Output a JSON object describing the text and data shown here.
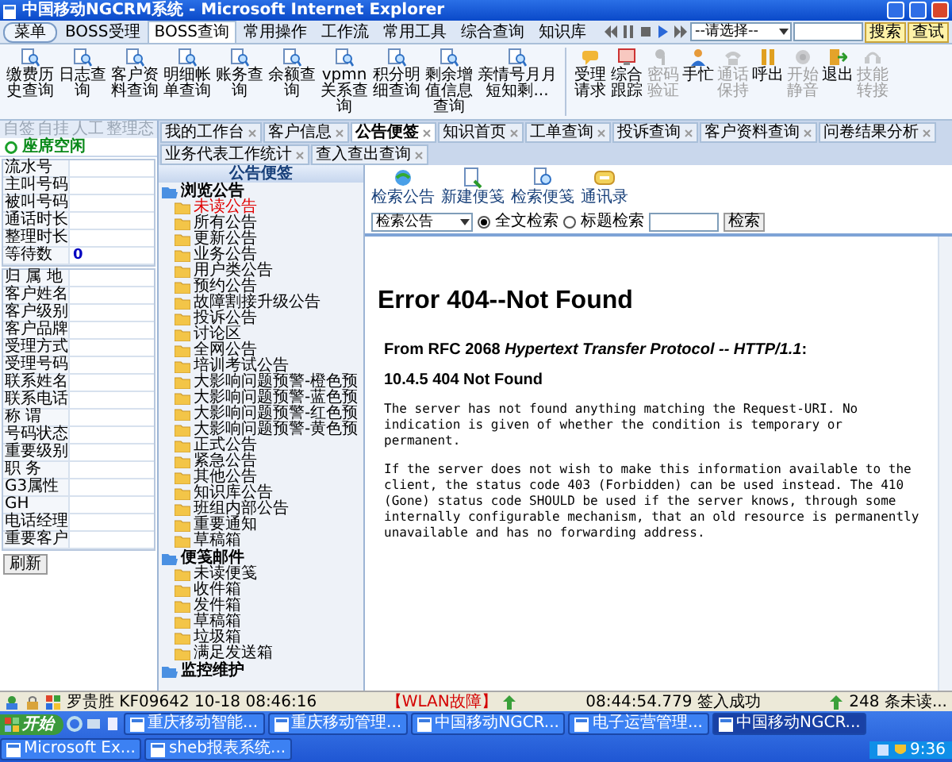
{
  "window": {
    "title": "中国移动NGCRM系统 - Microsoft Internet Explorer"
  },
  "menu_bar": {
    "menu_button": "菜单",
    "tabs": [
      {
        "label": "BOSS受理",
        "selected": false
      },
      {
        "label": "BOSS查询",
        "selected": true
      },
      {
        "label": "常用操作",
        "selected": false
      },
      {
        "label": "工作流",
        "selected": false
      },
      {
        "label": "常用工具",
        "selected": false
      },
      {
        "label": "综合查询",
        "selected": false
      },
      {
        "label": "知识库",
        "selected": false
      }
    ],
    "select": "--请选择--",
    "search_button": "搜索",
    "query_button": "查试"
  },
  "toolbar": {
    "query_tools": [
      {
        "label": "缴费历史查询"
      },
      {
        "label": "日志查询"
      },
      {
        "label": "客户资料查询"
      },
      {
        "label": "明细帐单查询"
      },
      {
        "label": "账务查询"
      },
      {
        "label": "余额查询"
      },
      {
        "label": "vpmn关系查询"
      },
      {
        "label": "积分明细查询"
      },
      {
        "label": "剩余增值信息查询"
      },
      {
        "label": "亲情号月月短知剩..."
      }
    ],
    "call_tools": [
      {
        "label": "受理请求",
        "disabled": false
      },
      {
        "label": "综合跟踪",
        "disabled": false
      },
      {
        "label": "密码验证",
        "disabled": true
      },
      {
        "label": "手忙",
        "disabled": false
      },
      {
        "label": "通话保持",
        "disabled": true
      },
      {
        "label": "呼出",
        "disabled": false
      },
      {
        "label": "开始静音",
        "disabled": true
      },
      {
        "label": "退出",
        "disabled": false
      },
      {
        "label": "技能转接",
        "disabled": true
      }
    ]
  },
  "agent_panel": {
    "tabs": [
      {
        "label": "自签",
        "disabled": true
      },
      {
        "label": "自挂",
        "disabled": true
      },
      {
        "label": "人工",
        "disabled": true
      },
      {
        "label": "整理态",
        "disabled": true
      }
    ],
    "status": "座席空闲",
    "call_fields": [
      {
        "label": "流水号"
      },
      {
        "label": "主叫号码"
      },
      {
        "label": "被叫号码"
      },
      {
        "label": "通话时长"
      },
      {
        "label": "整理时长"
      },
      {
        "label": "等待数",
        "value": "0"
      }
    ],
    "customer_fields": [
      {
        "label": "归 属 地"
      },
      {
        "label": "客户姓名"
      },
      {
        "label": "客户级别"
      },
      {
        "label": "客户品牌"
      },
      {
        "label": "受理方式"
      },
      {
        "label": "受理号码"
      },
      {
        "label": "联系姓名"
      },
      {
        "label": "联系电话"
      },
      {
        "label": "称 谓"
      },
      {
        "label": "号码状态"
      },
      {
        "label": "重要级别"
      },
      {
        "label": "职 务"
      },
      {
        "label": "G3属性"
      },
      {
        "label": "GH"
      },
      {
        "label": "电话经理"
      },
      {
        "label": "重要客户"
      }
    ],
    "refresh_button": "刷新"
  },
  "content_tabs": [
    {
      "label": "我的工作台",
      "selected": false
    },
    {
      "label": "客户信息",
      "selected": false
    },
    {
      "label": "公告便签",
      "selected": true
    },
    {
      "label": "知识首页",
      "selected": false
    },
    {
      "label": "工单查询",
      "selected": false
    },
    {
      "label": "投诉查询",
      "selected": false
    },
    {
      "label": "客户资料查询",
      "selected": false
    },
    {
      "label": "问卷结果分析",
      "selected": false
    },
    {
      "label": "业务代表工作统计",
      "selected": false
    },
    {
      "label": "查入查出查询",
      "selected": false
    }
  ],
  "notice_panel": {
    "title": "公告便签",
    "sections": [
      {
        "label": "浏览公告",
        "children": [
          {
            "label": "未读公告",
            "selected": true
          },
          {
            "label": "所有公告",
            "selected": false
          },
          {
            "label": "更新公告",
            "selected": false
          },
          {
            "label": "业务公告",
            "selected": false
          },
          {
            "label": "用户类公告",
            "selected": false
          },
          {
            "label": "预约公告",
            "selected": false
          },
          {
            "label": "故障割接升级公告",
            "selected": false
          },
          {
            "label": "投诉公告",
            "selected": false
          },
          {
            "label": "讨论区",
            "selected": false
          },
          {
            "label": "全网公告",
            "selected": false
          },
          {
            "label": "培训考试公告",
            "selected": false
          },
          {
            "label": "大影响问题预警-橙色预",
            "selected": false
          },
          {
            "label": "大影响问题预警-蓝色预",
            "selected": false
          },
          {
            "label": "大影响问题预警-红色预",
            "selected": false
          },
          {
            "label": "大影响问题预警-黄色预",
            "selected": false
          },
          {
            "label": "正式公告",
            "selected": false
          },
          {
            "label": "紧急公告",
            "selected": false
          },
          {
            "label": "其他公告",
            "selected": false
          },
          {
            "label": "知识库公告",
            "selected": false
          },
          {
            "label": "班组内部公告",
            "selected": false
          },
          {
            "label": "重要通知",
            "selected": false
          },
          {
            "label": "草稿箱",
            "selected": false
          }
        ]
      },
      {
        "label": "便笺邮件",
        "children": [
          {
            "label": "未读便笺",
            "selected": false
          },
          {
            "label": "收件箱",
            "selected": false
          },
          {
            "label": "发件箱",
            "selected": false
          },
          {
            "label": "草稿箱",
            "selected": false
          },
          {
            "label": "垃圾箱",
            "selected": false
          },
          {
            "label": "满足发送箱",
            "selected": false
          }
        ]
      },
      {
        "label": "监控维护"
      }
    ]
  },
  "notice_toolbar": {
    "actions": [
      "检索公告",
      "新建便笺",
      "检索便笺",
      "通讯录"
    ],
    "scope_select": "检索公告",
    "search_modes": [
      {
        "label": "全文检索",
        "selected": true
      },
      {
        "label": "标题检索",
        "selected": false
      }
    ],
    "search_button": "检索"
  },
  "error_page": {
    "heading": "Error 404--Not Found",
    "source": "From RFC 2068 *Hypertext Transfer Protocol -- HTTP/1.1*:",
    "section": "10.4.5 404 Not Found",
    "paragraphs": [
      "The server has not found anything matching the Request-URI. No indication is given of whether the condition is temporary or permanent.",
      "If the server does not wish to make this information available to the client, the status code 403 (Forbidden) can be used instead. The 410 (Gone) status code SHOULD be used if the server knows, through some internally configurable mechanism, that an old resource is permanently unavailable and has no forwarding address."
    ]
  },
  "status_bar": {
    "agent": "罗贵胜 KF09642 10-18 08:46:16",
    "alert": "【WLAN故障】",
    "login": "08:44:54.779 签入成功",
    "unread": "248 条未读..."
  },
  "taskbar": {
    "start": "开始",
    "windows": [
      {
        "label": "重庆移动智能...",
        "selected": false
      },
      {
        "label": "重庆移动管理...",
        "selected": false
      },
      {
        "label": "中国移动NGCR...",
        "selected": false
      },
      {
        "label": "电子运营管理...",
        "selected": false
      },
      {
        "label": "中国移动NGCR...",
        "selected": true
      },
      {
        "label": "Microsoft Ex...",
        "selected": false
      },
      {
        "label": "sheb报表系统...",
        "selected": false
      }
    ],
    "clock": "9:36"
  }
}
